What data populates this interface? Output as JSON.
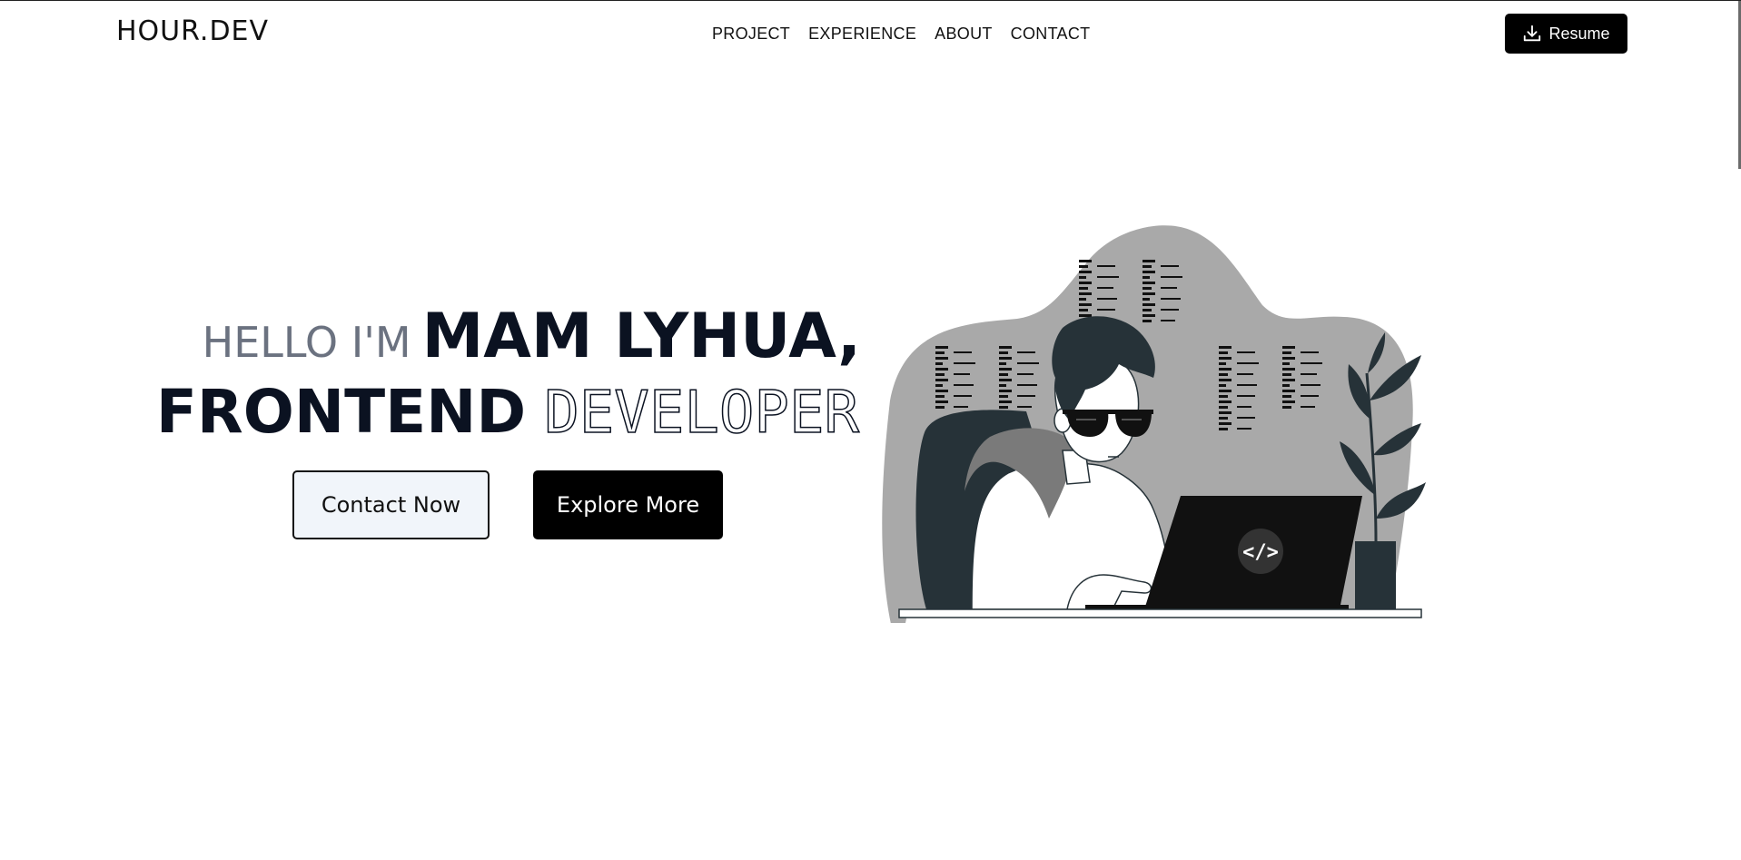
{
  "nav": {
    "logo": "HOUR.DEV",
    "links": [
      "PROJECT",
      "EXPERIENCE",
      "ABOUT",
      "CONTACT"
    ],
    "resume_label": "Resume",
    "resume_icon": "download-icon"
  },
  "hero": {
    "greeting": "HELLO I'M",
    "name": "MAM LYHUA,",
    "role_solid": "FRONTEND",
    "role_outline": "DEVELOPER",
    "contact_button": "Contact Now",
    "explore_button": "Explore More"
  },
  "illustration": {
    "subject": "developer-at-laptop-illustration",
    "laptop_code_glyph": "</>"
  },
  "colors": {
    "text_dark": "#0b1221",
    "text_gray": "#6b7280",
    "button_dark": "#000000",
    "button_light": "#f1f5fa",
    "blob_gray": "#a9a9a9",
    "ink": "#263238"
  }
}
